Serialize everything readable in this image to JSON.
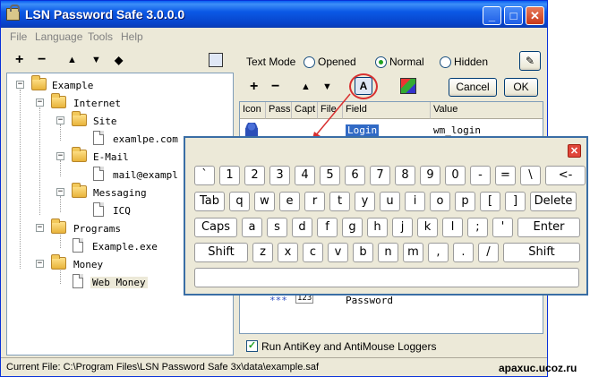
{
  "window": {
    "title": "LSN Password Safe 3.0.0.0"
  },
  "menu": [
    "File",
    "Language",
    "Tools",
    "Help"
  ],
  "left_toolbar": {
    "add": "+",
    "remove": "−",
    "up": "▲",
    "down": "▼",
    "updown": "◆"
  },
  "tree": {
    "root": "Example",
    "internet": "Internet",
    "site": "Site",
    "site_entry": "examlpe.com",
    "email": "E-Mail",
    "email_entry": "mail@exampl",
    "messaging": "Messaging",
    "messaging_entry": "ICQ",
    "programs": "Programs",
    "programs_entry": "Example.exe",
    "money": "Money",
    "money_entry": "Web Money"
  },
  "text_mode": {
    "label": "Text Mode",
    "options": [
      "Opened",
      "Normal",
      "Hidden"
    ],
    "selected": "Normal"
  },
  "right_toolbar": {
    "add": "+",
    "remove": "−",
    "up": "▲",
    "down": "▼",
    "cancel": "Cancel",
    "ok": "OK"
  },
  "grid": {
    "columns": [
      "Icon",
      "Pass",
      "Capt",
      "File",
      "Field",
      "Value"
    ],
    "rows": [
      {
        "field": "Login",
        "value": "wm_login"
      },
      {
        "pass": "***",
        "file": "123",
        "field": "Password",
        "value": ""
      }
    ]
  },
  "keyboard": {
    "close": "✕",
    "rows": [
      [
        "`",
        "1",
        "2",
        "3",
        "4",
        "5",
        "6",
        "7",
        "8",
        "9",
        "0",
        "-",
        "=",
        "\\",
        "<-"
      ],
      [
        "Tab",
        "q",
        "w",
        "e",
        "r",
        "t",
        "y",
        "u",
        "i",
        "o",
        "p",
        "[",
        "]",
        "Delete"
      ],
      [
        "Caps",
        "a",
        "s",
        "d",
        "f",
        "g",
        "h",
        "j",
        "k",
        "l",
        ";",
        "'",
        "Enter"
      ],
      [
        "Shift",
        "z",
        "x",
        "c",
        "v",
        "b",
        "n",
        "m",
        ",",
        ".",
        "/",
        "Shift"
      ]
    ]
  },
  "antikey": {
    "label": "Run AntiKey and AntiMouse Loggers",
    "checked": true
  },
  "status": {
    "text": "Current File: C:\\Program Files\\LSN Password Safe 3x\\data\\example.saf"
  },
  "watermark": "apaxuc.ucoz.ru",
  "colors": {
    "title_bar": "#0a5ef1",
    "highlight_circle": "#d83030",
    "selection": "#316ac5"
  }
}
